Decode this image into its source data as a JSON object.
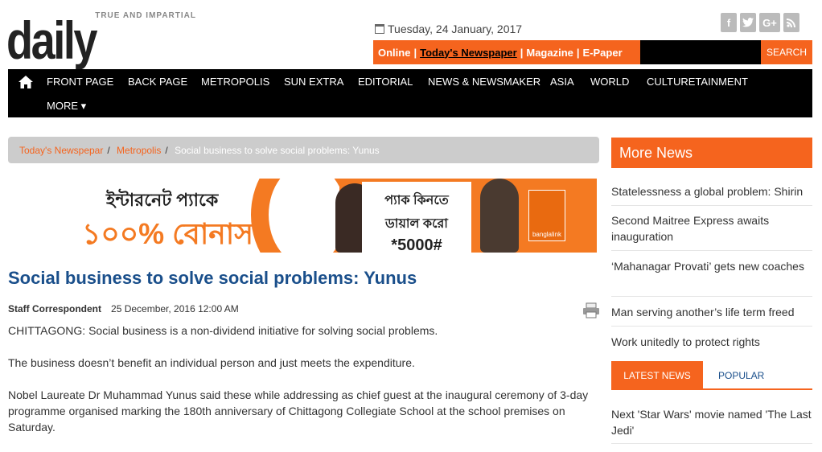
{
  "header": {
    "logo_tagline": "TRUE AND IMPARTIAL",
    "logo_name": "daily sun",
    "date": "Tuesday, 24 January, 2017",
    "social": [
      "f",
      "t",
      "G+",
      "rss"
    ],
    "top_links": [
      "Online",
      "Today's Newspaper",
      "Magazine",
      "E-Paper"
    ],
    "search_label": "SEARCH",
    "search_placeholder": ""
  },
  "nav": {
    "items": [
      "FRONT PAGE",
      "BACK PAGE",
      "METROPOLIS",
      "SUN EXTRA",
      "EDITORIAL",
      "NEWS & NEWSMAKER",
      "ASIA",
      "WORLD",
      "CULTURETAINMENT"
    ],
    "more_label": "MORE ▾"
  },
  "breadcrumb": {
    "items": [
      "Today's Newspepar",
      "Metropolis"
    ],
    "current": "Social business to solve social problems: Yunus"
  },
  "banner": {
    "line1": "ইন্টারনেট প্যাকে",
    "line2": "১০০% বোনাস",
    "mid1": "প্যাক কিনতে",
    "mid2": "ডায়াল করো",
    "mid3": "*5000#",
    "brand": "banglalink"
  },
  "article": {
    "title": "Social business to solve social problems: Yunus",
    "author": "Staff Correspondent",
    "timestamp": "25 December, 2016 12:00 AM",
    "paragraphs": [
      "CHITTAGONG: Social business is a non-dividend initiative for solving social problems.",
      "The business doesn’t benefit an individual person and just meets the expenditure.",
      "Nobel Laureate Dr Muhammad Yunus said these while addressing as chief guest at the inaugural ceremony of 3-day programme organised marking the 180th anniversary of Chittagong Collegiate School at the school premises on Saturday."
    ]
  },
  "sidebar": {
    "title": "More News",
    "news": [
      "Statelessness a global problem: Shirin",
      "Second Maitree Express awaits inauguration",
      "‘Mahanagar Provati’ gets new coaches",
      "Man serving another’s life term freed",
      "Work unitedly to protect rights"
    ],
    "tabs": [
      "LATEST NEWS",
      "POPULAR"
    ],
    "latest": [
      "Next 'Star Wars' movie named 'The Last Jedi'"
    ]
  }
}
